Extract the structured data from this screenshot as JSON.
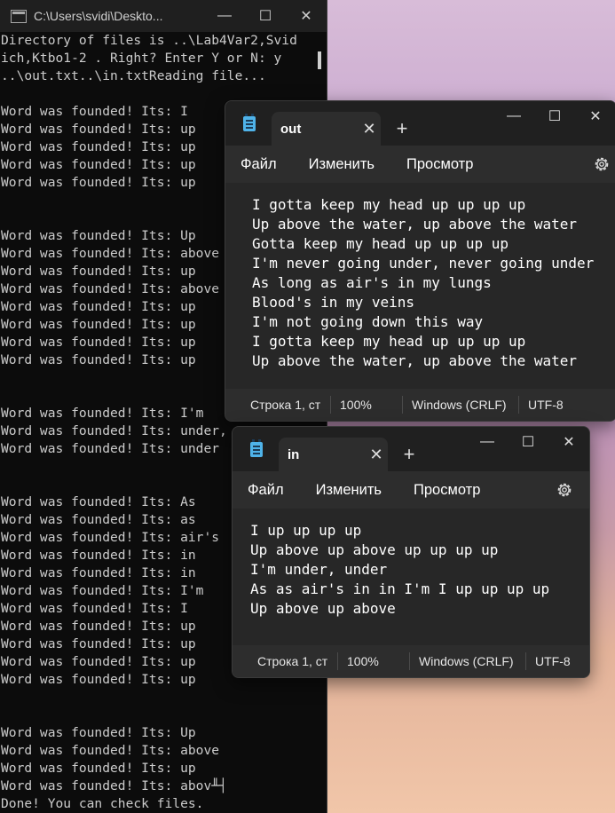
{
  "console": {
    "title": "C:\\Users\\svidi\\Deskto...",
    "lines": [
      "Directory of files is ..\\Lab4Var2,Svid",
      "ich,Ktbo1-2 . Right? Enter Y or N: y",
      "..\\out.txt..\\in.txtReading file...",
      "",
      "Word was founded! Its: I",
      "Word was founded! Its: up",
      "Word was founded! Its: up",
      "Word was founded! Its: up",
      "Word was founded! Its: up",
      "",
      "",
      "Word was founded! Its: Up",
      "Word was founded! Its: above",
      "Word was founded! Its: up",
      "Word was founded! Its: above",
      "Word was founded! Its: up",
      "Word was founded! Its: up",
      "Word was founded! Its: up",
      "Word was founded! Its: up",
      "",
      "",
      "Word was founded! Its: I'm",
      "Word was founded! Its: under,",
      "Word was founded! Its: under",
      "",
      "",
      "Word was founded! Its: As",
      "Word was founded! Its: as",
      "Word was founded! Its: air's",
      "Word was founded! Its: in",
      "Word was founded! Its: in",
      "Word was founded! Its: I'm",
      "Word was founded! Its: I",
      "Word was founded! Its: up",
      "Word was founded! Its: up",
      "Word was founded! Its: up",
      "Word was founded! Its: up",
      "",
      "",
      "Word was founded! Its: Up",
      "Word was founded! Its: above",
      "Word was founded! Its: up",
      "Word was founded! Its: abov╨┤",
      "Done! You can check files."
    ]
  },
  "notepad_out": {
    "tab_title": "out",
    "menu": [
      "Файл",
      "Изменить",
      "Просмотр"
    ],
    "content": "I gotta keep my head up up up up\nUp above the water, up above the water\nGotta keep my head up up up up\nI'm never going under, never going under\nAs long as air's in my lungs\nBlood's in my veins\nI'm not going down this way\nI gotta keep my head up up up up\nUp above the water, up above the water",
    "status": {
      "position": "Строка 1, ст",
      "zoom": "100%",
      "line_ending": "Windows (CRLF)",
      "encoding": "UTF-8"
    }
  },
  "notepad_in": {
    "tab_title": "in",
    "menu": [
      "Файл",
      "Изменить",
      "Просмотр"
    ],
    "content": "I up up up up\nUp above up above up up up up\nI'm under, under\nAs as air's in in I'm I up up up up\nUp above up above",
    "status": {
      "position": "Строка 1, ст",
      "zoom": "100%",
      "line_ending": "Windows (CRLF)",
      "encoding": "UTF-8"
    }
  }
}
